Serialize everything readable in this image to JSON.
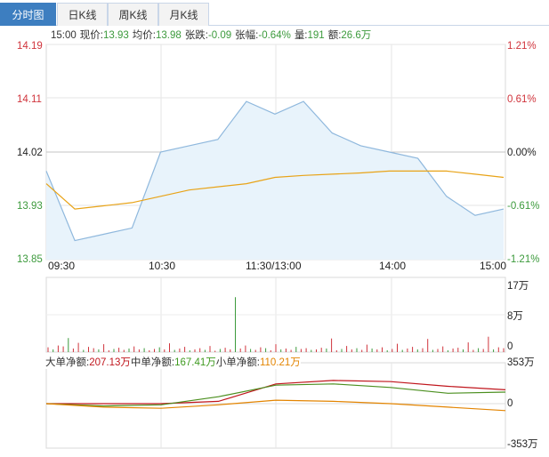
{
  "tabs": [
    {
      "label": "分时图",
      "active": true
    },
    {
      "label": "日K线",
      "active": false
    },
    {
      "label": "周K线",
      "active": false
    },
    {
      "label": "月K线",
      "active": false
    }
  ],
  "info": {
    "time": "15:00",
    "price_label": "现价:",
    "price": "13.93",
    "avg_label": "均价:",
    "avg": "13.98",
    "change_label": "张跌:",
    "change": "-0.09",
    "pct_label": "张幅:",
    "pct": "-0.64%",
    "vol_label": "量:",
    "vol": "191",
    "amount_label": "额:",
    "amount": "26.6万"
  },
  "price_axis": [
    "14.19",
    "14.11",
    "14.02",
    "13.93",
    "13.85"
  ],
  "pct_axis": [
    "1.21%",
    "0.61%",
    "0.00%",
    "-0.61%",
    "-1.21%"
  ],
  "time_axis": [
    "09:30",
    "10:30",
    "11:30/13:00",
    "14:00",
    "15:00"
  ],
  "volume_axis": [
    "17万",
    "8万",
    "0"
  ],
  "flow_axis": [
    "353万",
    "0",
    "-353万"
  ],
  "flow": {
    "large_label": "大单净额:",
    "large_value": "207.13万",
    "medium_label": "中单净额:",
    "medium_value": "167.41万",
    "small_label": "小单净额:",
    "small_value": "110.21万"
  },
  "colors": {
    "price_line": "#8fb8dd",
    "price_fill": "#e8f3fb",
    "avg_line": "#e8a317",
    "large_flow": "#c0161d",
    "medium_flow": "#4b8f1f",
    "small_flow": "#e38400",
    "up": "#d0343c",
    "down": "#3c9a3c"
  },
  "chart_data": [
    {
      "type": "line",
      "x": [
        "09:30",
        "09:45",
        "10:00",
        "10:15",
        "10:30",
        "10:45",
        "11:00",
        "11:15",
        "11:30/13:00",
        "13:15",
        "13:30",
        "13:45",
        "14:00",
        "14:15",
        "14:30",
        "14:45",
        "15:00"
      ],
      "series": [
        {
          "values": [
            13.99,
            13.88,
            13.89,
            13.9,
            14.02,
            14.03,
            14.04,
            14.1,
            14.08,
            14.1,
            14.05,
            14.03,
            14.02,
            14.01,
            13.95,
            13.92,
            13.93
          ]
        },
        {
          "values": [
            13.97,
            13.93,
            13.935,
            13.94,
            13.95,
            13.96,
            13.965,
            13.97,
            13.98,
            13.983,
            13.985,
            13.987,
            13.99,
            13.99,
            13.99,
            13.985,
            13.98
          ]
        }
      ],
      "ylim": [
        13.85,
        14.19
      ],
      "y_ticks": [
        "14.19",
        "14.11",
        "14.02",
        "13.93",
        "13.85"
      ],
      "y2_ticks": [
        "1.21%",
        "0.61%",
        "0.00%",
        "-0.61%",
        "-1.21%"
      ],
      "x_ticks": [
        "09:30",
        "10:30",
        "11:30/13:00",
        "14:00",
        "15:00"
      ],
      "grid": true
    },
    {
      "type": "bar",
      "ylim": [
        0,
        17
      ],
      "y_ticks": [
        "17万",
        "8万",
        "0"
      ],
      "values": [
        1.1,
        0.6,
        1.5,
        1.3,
        3.2,
        0.8,
        2.1,
        0.5,
        1.2,
        0.9,
        0.6,
        1.8,
        0.4,
        0.7,
        1.0,
        0.5,
        0.8,
        1.3,
        0.6,
        0.9,
        0.4,
        0.7,
        1.1,
        0.6,
        2.0,
        0.5,
        0.8,
        1.2,
        0.4,
        0.6,
        0.9,
        0.5,
        1.4,
        0.3,
        0.7,
        1.0,
        0.6,
        12.5,
        0.8,
        1.5,
        0.7,
        0.5,
        1.1,
        0.9,
        0.4,
        1.8,
        0.6,
        0.8,
        0.5,
        1.2,
        0.7,
        0.9,
        0.5,
        0.6,
        1.0,
        0.8,
        3.1,
        0.4,
        0.7,
        1.4,
        0.6,
        0.9,
        0.5,
        1.7,
        0.8,
        0.6,
        1.1,
        0.4,
        0.7,
        1.9,
        0.5,
        0.8,
        1.2,
        0.6,
        0.9,
        3.0,
        0.5,
        0.7,
        1.3,
        0.4,
        0.8,
        1.0,
        0.6,
        2.2,
        0.5,
        0.9,
        0.7,
        3.5,
        0.6,
        1.1,
        0.9
      ]
    },
    {
      "type": "line",
      "x": [
        "09:30",
        "10:00",
        "10:30",
        "11:00",
        "11:30/13:00",
        "13:30",
        "14:00",
        "14:30",
        "15:00"
      ],
      "series": [
        {
          "name": "大单净额",
          "values": [
            0,
            0,
            0,
            20,
            170,
            200,
            190,
            150,
            120
          ]
        },
        {
          "name": "中单净额",
          "values": [
            0,
            -20,
            -10,
            60,
            160,
            170,
            140,
            90,
            100
          ]
        },
        {
          "name": "小单净额",
          "values": [
            0,
            -30,
            -40,
            -10,
            30,
            20,
            0,
            -30,
            -60
          ]
        }
      ],
      "ylim": [
        -353,
        353
      ],
      "y_ticks": [
        "353万",
        "0",
        "-353万"
      ]
    }
  ]
}
